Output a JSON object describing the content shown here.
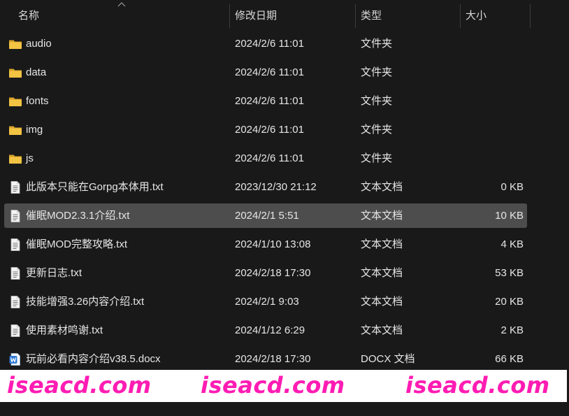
{
  "columns": {
    "name": "名称",
    "date": "修改日期",
    "type": "类型",
    "size": "大小"
  },
  "files": [
    {
      "name": "audio",
      "date": "2024/2/6 11:01",
      "type": "文件夹",
      "size": "",
      "icon": "folder-icon",
      "selected": false
    },
    {
      "name": "data",
      "date": "2024/2/6 11:01",
      "type": "文件夹",
      "size": "",
      "icon": "folder-icon",
      "selected": false
    },
    {
      "name": "fonts",
      "date": "2024/2/6 11:01",
      "type": "文件夹",
      "size": "",
      "icon": "folder-icon",
      "selected": false
    },
    {
      "name": "img",
      "date": "2024/2/6 11:01",
      "type": "文件夹",
      "size": "",
      "icon": "folder-icon",
      "selected": false
    },
    {
      "name": "js",
      "date": "2024/2/6 11:01",
      "type": "文件夹",
      "size": "",
      "icon": "folder-icon",
      "selected": false
    },
    {
      "name": "此版本只能在Gorpg本体用.txt",
      "date": "2023/12/30 21:12",
      "type": "文本文档",
      "size": "0 KB",
      "icon": "text-file-icon",
      "selected": false
    },
    {
      "name": "催眠MOD2.3.1介绍.txt",
      "date": "2024/2/1 5:51",
      "type": "文本文档",
      "size": "10 KB",
      "icon": "text-file-icon",
      "selected": true
    },
    {
      "name": "催眠MOD完整攻略.txt",
      "date": "2024/1/10 13:08",
      "type": "文本文档",
      "size": "4 KB",
      "icon": "text-file-icon",
      "selected": false
    },
    {
      "name": "更新日志.txt",
      "date": "2024/2/18 17:30",
      "type": "文本文档",
      "size": "53 KB",
      "icon": "text-file-icon",
      "selected": false
    },
    {
      "name": "技能增强3.26内容介绍.txt",
      "date": "2024/2/1 9:03",
      "type": "文本文档",
      "size": "20 KB",
      "icon": "text-file-icon",
      "selected": false
    },
    {
      "name": "使用素材鸣谢.txt",
      "date": "2024/1/12 6:29",
      "type": "文本文档",
      "size": "2 KB",
      "icon": "text-file-icon",
      "selected": false
    },
    {
      "name": "玩前必看内容介绍v38.5.docx",
      "date": "2024/2/18 17:30",
      "type": "DOCX 文档",
      "size": "66 KB",
      "icon": "word-doc-icon",
      "selected": false
    }
  ],
  "watermark": {
    "texts": [
      "iseacd.com",
      "iseacd.com",
      "iseacd.com"
    ],
    "color": "#ff1cb3"
  },
  "colors": {
    "background": "#191919",
    "selected_row": "#4d4d4d",
    "folder": "#f3c343",
    "word_blue": "#2f7bd6"
  }
}
